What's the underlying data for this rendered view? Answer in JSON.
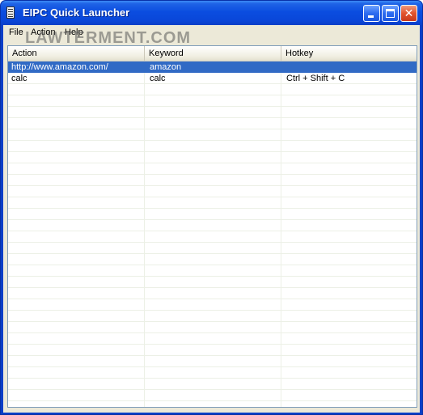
{
  "window": {
    "title": "EIPC Quick Launcher"
  },
  "menu": {
    "file": "File",
    "action": "Action",
    "help": "Help"
  },
  "watermark": "LAWTERMENT.COM",
  "table": {
    "columns": [
      "Action",
      "Keyword",
      "Hotkey"
    ],
    "rows": [
      {
        "action": "http://www.amazon.com/",
        "keyword": "amazon",
        "hotkey": ""
      },
      {
        "action": "calc",
        "keyword": "calc",
        "hotkey": "Ctrl + Shift + C"
      }
    ]
  },
  "icons": {
    "app": "app-icon",
    "minimize": "minimize-icon",
    "maximize": "maximize-icon",
    "close": "close-icon"
  },
  "colors": {
    "titlebar": "#0a47d9",
    "selection": "#316ac5",
    "close_button": "#e2532d"
  }
}
